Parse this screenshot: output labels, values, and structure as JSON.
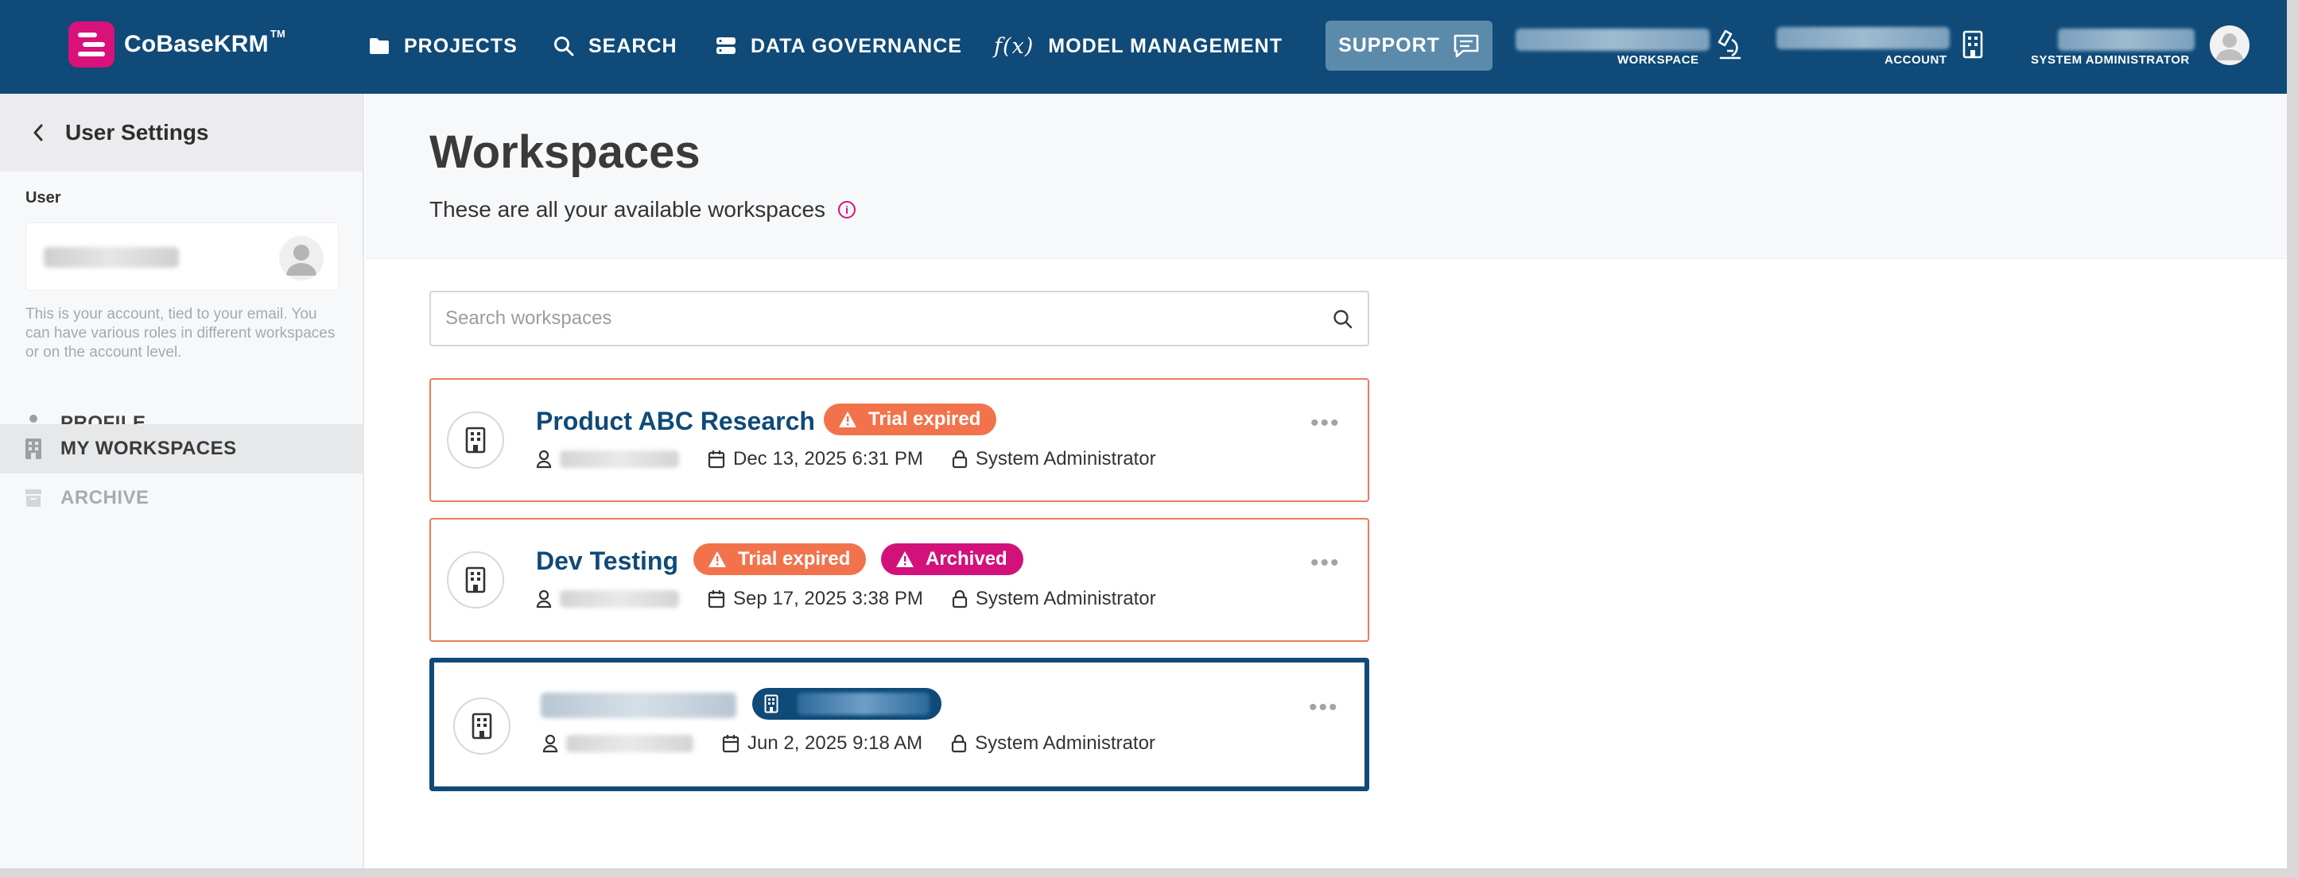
{
  "brand": {
    "name": "CoBaseKRM",
    "trademark": "TM"
  },
  "nav": [
    {
      "label": "PROJECTS",
      "icon": "folder-icon"
    },
    {
      "label": "SEARCH",
      "icon": "search-icon"
    },
    {
      "label": "DATA GOVERNANCE",
      "icon": "database-icon"
    },
    {
      "label": "MODEL MANAGEMENT",
      "icon": "function-icon",
      "glyph": "f(x)"
    }
  ],
  "support": {
    "label": "SUPPORT",
    "icon": "chat-icon"
  },
  "context": {
    "workspace_caption": "WORKSPACE",
    "account_caption": "ACCOUNT",
    "role_caption": "SYSTEM ADMINISTRATOR"
  },
  "sidebar": {
    "back_title": "User Settings",
    "user_label": "User",
    "user_note": "This is your account, tied to your email. You can have various roles in different workspaces or on the account level.",
    "items": [
      {
        "label": "PROFILE",
        "icon": "person-icon",
        "active": false
      },
      {
        "label": "MY WORKSPACES",
        "icon": "building-icon",
        "active": true
      },
      {
        "label": "ARCHIVE",
        "icon": "archive-icon",
        "active": false,
        "disabled": true
      }
    ]
  },
  "main": {
    "title": "Workspaces",
    "subtitle": "These are all your available workspaces",
    "search_placeholder": "Search workspaces"
  },
  "workspaces": [
    {
      "title": "Product ABC Research",
      "badges": [
        "Trial expired"
      ],
      "date": "Dec 13, 2025 6:31 PM",
      "role": "System Administrator"
    },
    {
      "title": "Dev Testing",
      "badges": [
        "Trial expired",
        "Archived"
      ],
      "date": "Sep 17, 2025 3:38 PM",
      "role": "System Administrator"
    },
    {
      "title": "",
      "badges": [],
      "date": "Jun 2, 2025 9:18 AM",
      "role": "System Administrator",
      "selected": true
    }
  ],
  "colors": {
    "topbar": "#0f4a78",
    "brand_accent": "#d8127a",
    "trial_badge": "#f2734b",
    "archived_badge": "#d2127a",
    "card_warning_border": "#ef7a5a"
  }
}
